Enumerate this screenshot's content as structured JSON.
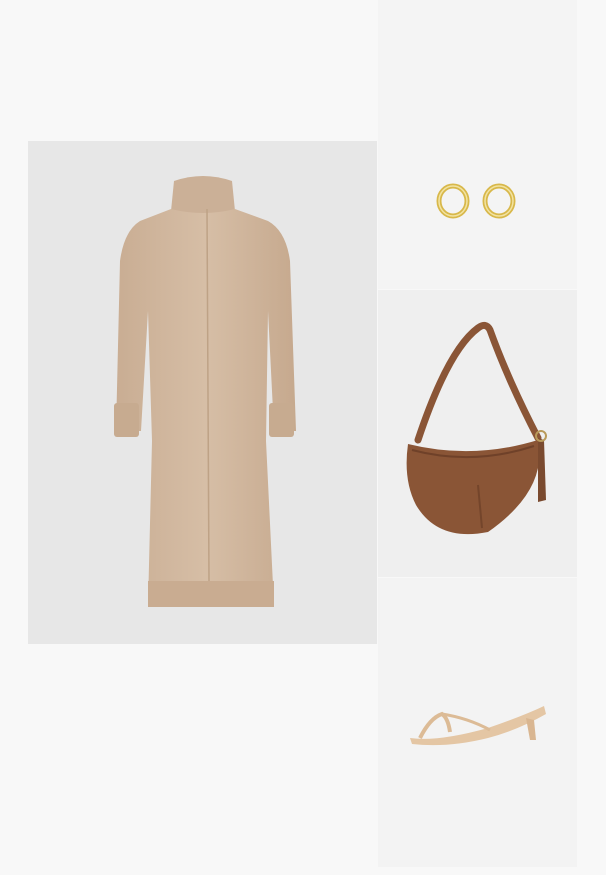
{
  "collage": {
    "background_color": "#f8f8f8",
    "items": [
      {
        "id": "dress",
        "kind": "beige turtleneck knit dress",
        "color": "#cdb39a",
        "tile_color": "#e7e7e7"
      },
      {
        "id": "earrings",
        "kind": "gold hoop earrings",
        "color": "#d8b84a",
        "tile_color": "#f4f4f4"
      },
      {
        "id": "bag",
        "kind": "brown suede crescent shoulder bag",
        "color": "#8a5536",
        "tile_color": "#efefef"
      },
      {
        "id": "sandals",
        "kind": "beige thong kitten-heel sandals",
        "color": "#e4c6a4",
        "tile_color": "#f3f3f3"
      }
    ]
  }
}
